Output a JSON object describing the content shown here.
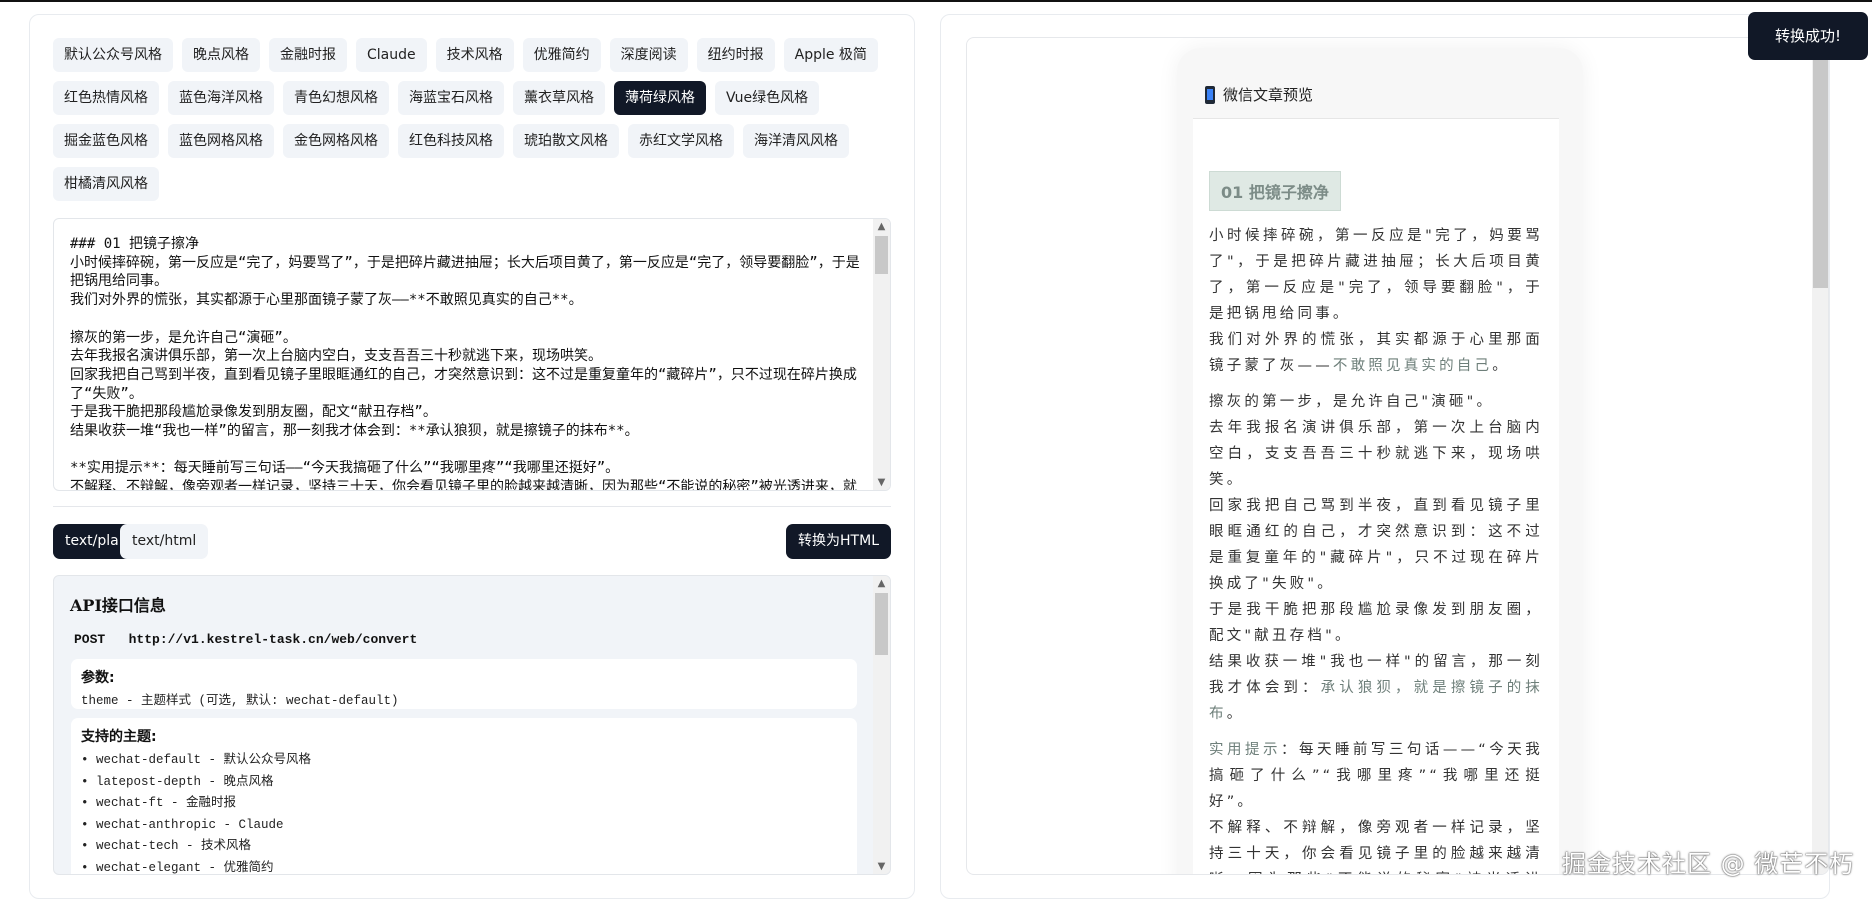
{
  "themes": [
    "默认公众号风格",
    "晚点风格",
    "金融时报",
    "Claude",
    "技术风格",
    "优雅简约",
    "深度阅读",
    "纽约时报",
    "Apple 极简",
    "红色热情风格",
    "蓝色海洋风格",
    "青色幻想风格",
    "海蓝宝石风格",
    "薰衣草风格",
    "薄荷绿风格",
    "Vue绿色风格",
    "掘金蓝色风格",
    "蓝色网格风格",
    "金色网格风格",
    "红色科技风格",
    "琥珀散文风格",
    "赤红文学风格",
    "海洋清风风格",
    "柑橘清风风格"
  ],
  "active_theme": "薄荷绿风格",
  "editor_text": "### 01 把镜子擦净\n小时候摔碎碗，第一反应是“完了，妈要骂了”，于是把碎片藏进抽屉；长大后项目黄了，第一反应是“完了，领导要翻脸”，于是把锅甩给同事。\n我们对外界的慌张，其实都源于心里那面镜子蒙了灰——**不敢照见真实的自己**。\n\n擦灰的第一步，是允许自己“演砸”。\n去年我报名演讲俱乐部，第一次上台脑内空白，支支吾吾三十秒就逃下来，现场哄笑。\n回家我把自己骂到半夜，直到看见镜子里眼眶通红的自己，才突然意识到：这不过是重复童年的“藏碎片”，只不过现在碎片换成了“失败”。\n于是我干脆把那段尴尬录像发到朋友圈，配文“献丑存档”。\n结果收获一堆“我也一样”的留言，那一刻我才体会到：**承认狼狈，就是擦镜子的抹布**。\n\n**实用提示**：每天睡前写三句话——“今天我搞砸了什么”“我哪里疼”“我哪里还挺好”。\n不解释、不辩解，像旁观者一样记录，坚持三十天，你会看见镜子里的脸越来越清晰，因为那些“不能说的秘密”被光透进来，就不再是暗伤。",
  "format_tabs": [
    "text/plain",
    "text/html"
  ],
  "convert_label": "转换为HTML",
  "api": {
    "title": "API接口信息",
    "method": "POST",
    "url": "http://v1.kestrel-task.cn/web/convert",
    "params_title": "参数:",
    "params": "theme - 主题样式 (可选, 默认: wechat-default)",
    "themes_title": "支持的主题:",
    "themes": [
      "• wechat-default - 默认公众号风格",
      "• latepost-depth - 晚点风格",
      "• wechat-ft - 金融时报",
      "• wechat-anthropic - Claude",
      "• wechat-tech - 技术风格",
      "• wechat-elegant - 优雅简约"
    ]
  },
  "preview": {
    "title": "微信文章预览",
    "heading": "01 把镜子擦净",
    "p1": "小时候摔碎碗，第一反应是\"完了，妈要骂了\"，于是把碎片藏进抽屉；长大后项目黄了，第一反应是\"完了，领导要翻脸\"，于是把锅甩给同事。",
    "p2a": "我们对外界的慌张，其实都源于心里那面镜子蒙了灰——",
    "p2b": "不敢照见真实的自己",
    "p2c": "。",
    "p3": "擦灰的第一步，是允许自己\"演砸\"。",
    "p4": "去年我报名演讲俱乐部，第一次上台脑内空白，支支吾吾三十秒就逃下来，现场哄笑。",
    "p5": "回家我把自己骂到半夜，直到看见镜子里眼眶通红的自己，才突然意识到：这不过是重复童年的\"藏碎片\"，只不过现在碎片换成了\"失败\"。",
    "p6": "于是我干脆把那段尴尬录像发到朋友圈，配文\"献丑存档\"。",
    "p7a": "结果收获一堆\"我也一样\"的留言，那一刻我才体会到：",
    "p7b": "承认狼狈，就是擦镜子的抹布",
    "p7c": "。",
    "p8a": "实用提示",
    "p8b": "：每天睡前写三句话——“今天我搞砸了什么”“我哪里疼”“我哪里还挺好”。",
    "p9": "不解释、不辩解，像旁观者一样记录，坚持三十天，你会看见镜子里的脸越来越清晰，因为那些\"不能说的秘密\"被光透进来，就不再是暗伤。"
  },
  "toast": "转换成功!",
  "watermark": "掘金技术社区 @ 微芒不朽",
  "colors": {
    "dark": "#111827",
    "accent": "#7fb0a0",
    "heading_bg": "#dfe9e4"
  }
}
